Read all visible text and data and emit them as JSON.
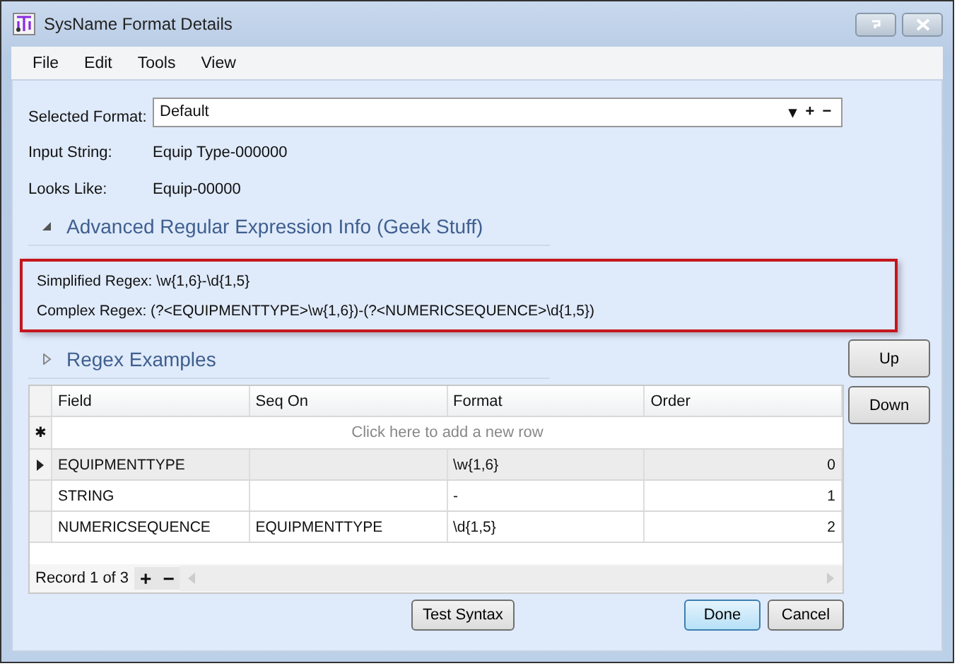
{
  "window": {
    "title": "SysName Format Details"
  },
  "menu": [
    "File",
    "Edit",
    "Tools",
    "View"
  ],
  "selected_format": {
    "label": "Selected Format:",
    "value": "Default",
    "dropdown": "▾",
    "add": "+",
    "remove": "−"
  },
  "fields": [
    {
      "label": "Input String:",
      "value": "Equip Type-000000"
    },
    {
      "label": "Looks Like:",
      "value": "Equip-00000"
    }
  ],
  "sections": [
    {
      "title": "Advanced Regular Expression Info (Geek Stuff)",
      "expanded": true,
      "lines": [
        {
          "label": "Simplified Regex:",
          "value": "\\w{1,6}-\\d{1,5}"
        },
        {
          "label": "Complex Regex:",
          "value": "(?<EQUIPMENTTYPE>\\w{1,6})-(?<NUMERICSEQUENCE>\\d{1,5})"
        }
      ]
    },
    {
      "title": "Regex Examples",
      "expanded": false
    }
  ],
  "side_buttons": [
    "Up",
    "Down"
  ],
  "table": {
    "columns": [
      "Field",
      "Seq On",
      "Format",
      "Order"
    ],
    "new_row_marker": "✱",
    "new_row_hint": "Click here to add a new row",
    "rows": [
      {
        "selected": true,
        "cells": [
          "EQUIPMENTTYPE",
          "",
          "\\w{1,6}",
          "0"
        ]
      },
      {
        "selected": false,
        "cells": [
          "STRING",
          "",
          "-",
          "1"
        ]
      },
      {
        "selected": false,
        "cells": [
          "NUMERICSEQUENCE",
          "EQUIPMENTTYPE",
          "\\d{1,5}",
          "2"
        ]
      }
    ],
    "record": "Record 1 of 3",
    "add": "+",
    "remove": "−"
  },
  "buttons": [
    {
      "label": "Test Syntax",
      "default": false
    },
    {
      "label": "Done",
      "default": true
    },
    {
      "label": "Cancel",
      "default": false
    }
  ]
}
